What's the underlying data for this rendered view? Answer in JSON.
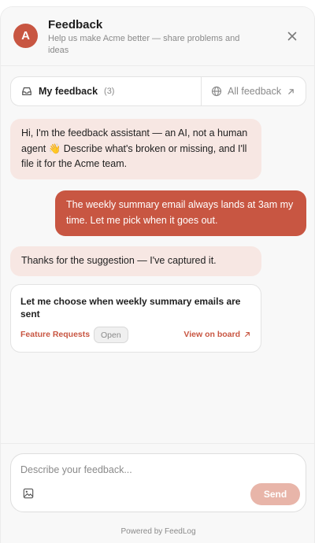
{
  "header": {
    "avatar_letter": "A",
    "title": "Feedback",
    "subtitle": "Help us make Acme better — share problems and ideas"
  },
  "tabs": {
    "mine_label": "My feedback",
    "mine_count": "(3)",
    "all_label": "All feedback"
  },
  "messages": {
    "assistant_greeting": "Hi, I'm the feedback assistant — an AI, not a human agent 👋 Describe what's broken or missing, and I'll file it for the Acme team.",
    "user_message": "The weekly summary email always lands at 3am my time. Let me pick when it goes out.",
    "assistant_ack": "Thanks for the suggestion — I've captured it."
  },
  "card": {
    "title": "Let me choose when weekly summary emails are sent",
    "category": "Feature Requests",
    "status": "Open",
    "link_label": "View on board"
  },
  "composer": {
    "placeholder": "Describe your feedback...",
    "send_label": "Send"
  },
  "footer": {
    "powered_by": "Powered by FeedLog"
  },
  "colors": {
    "accent": "#c85642",
    "assistant_bubble": "#f7e7e3",
    "send_disabled": "#e8b5a9"
  },
  "icons": {
    "close": "close-icon",
    "inbox": "inbox-icon",
    "globe": "globe-icon",
    "external": "external-link-icon",
    "image": "image-icon"
  }
}
